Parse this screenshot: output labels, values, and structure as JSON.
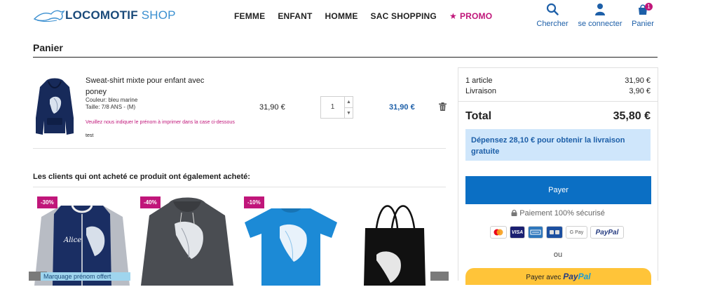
{
  "header": {
    "logo_brand": "LOCOMOTIF",
    "logo_suffix": "SHOP",
    "nav": [
      "FEMME",
      "ENFANT",
      "HOMME",
      "SAC SHOPPING"
    ],
    "promo_star": "★",
    "promo": "PROMO",
    "search_label": "Chercher",
    "account_label": "se connecter",
    "cart_label": "Panier",
    "cart_count": "1"
  },
  "page_title": "Panier",
  "cart_item": {
    "name": "Sweat-shirt mixte pour enfant avec poney",
    "color": "Couleur: bleu marine",
    "size": "Taille: 7/8 ANS - (M)",
    "note": "Veuillez nous indiquer le prénom à imprimer dans la case ci-dessous",
    "custom_text": "test",
    "unit_price": "31,90 €",
    "quantity": "1",
    "line_total": "31,90 €"
  },
  "also_bought": {
    "title": "Les clients qui ont acheté ce produit ont également acheté:",
    "products": [
      {
        "discount": "-30%",
        "name_on_image": "Alice"
      },
      {
        "discount": "-40%"
      },
      {
        "discount": "-10%"
      },
      {
        "discount": ""
      }
    ],
    "marquee_text": "Marquage prénom offert"
  },
  "summary": {
    "articles_label": "1 article",
    "articles_value": "31,90 €",
    "shipping_label": "Livraison",
    "shipping_value": "3,90 €",
    "total_label": "Total",
    "total_value": "35,80 €",
    "free_shipping_msg": "Dépensez 28,10 € pour obtenir la livraison gratuite",
    "pay_button": "Payer",
    "secure_text": "Paiement 100% sécurisé",
    "card_labels": [
      "VISA",
      "G Pay",
      "PayPal"
    ],
    "or_text": "ou",
    "paypal_prefix": "Payer avec",
    "paypal_pay": "Pay",
    "paypal_pal": "Pal"
  },
  "colors": {
    "brand_blue": "#1d5fa8",
    "promo_pink": "#c0167a",
    "pay_blue": "#0b6fc4",
    "paypal_yellow": "#ffc439",
    "info_bg": "#cfe6fb"
  }
}
